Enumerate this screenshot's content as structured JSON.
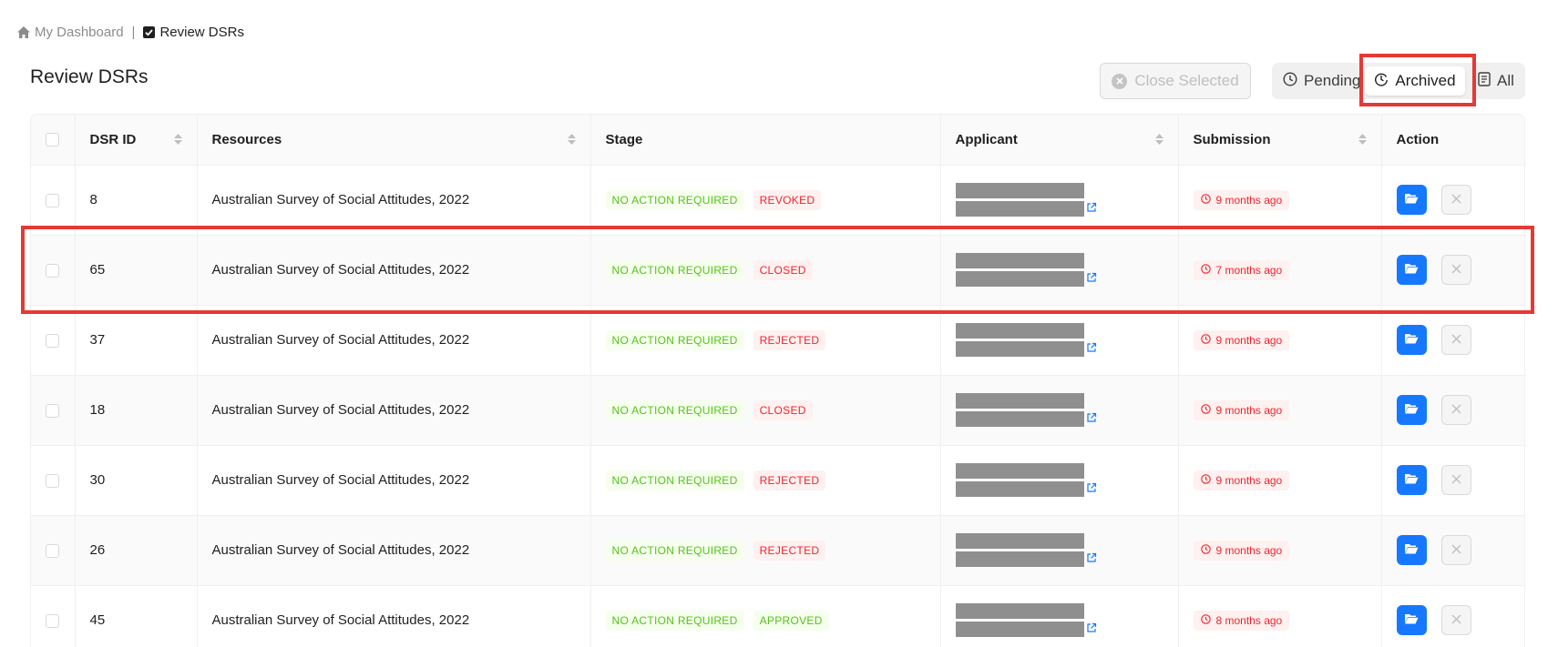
{
  "breadcrumb": {
    "home": "My Dashboard",
    "separator": "|",
    "current": "Review DSRs"
  },
  "page_title": "Review DSRs",
  "toolbar": {
    "close_selected": "Close Selected"
  },
  "filters": {
    "pending": "Pending",
    "archived": "Archived",
    "all": "All",
    "selected": "archived"
  },
  "table": {
    "columns": {
      "id": "DSR ID",
      "resources": "Resources",
      "stage": "Stage",
      "applicant": "Applicant",
      "submission": "Submission",
      "action": "Action"
    },
    "rows": [
      {
        "id": "8",
        "resource": "Australian Survey of Social Attitudes, 2022",
        "stage": "NO ACTION REQUIRED",
        "status": "REVOKED",
        "status_color": "red",
        "submitted": "9 months ago"
      },
      {
        "id": "65",
        "resource": "Australian Survey of Social Attitudes, 2022",
        "stage": "NO ACTION REQUIRED",
        "status": "CLOSED",
        "status_color": "red",
        "submitted": "7 months ago"
      },
      {
        "id": "37",
        "resource": "Australian Survey of Social Attitudes, 2022",
        "stage": "NO ACTION REQUIRED",
        "status": "REJECTED",
        "status_color": "red",
        "submitted": "9 months ago"
      },
      {
        "id": "18",
        "resource": "Australian Survey of Social Attitudes, 2022",
        "stage": "NO ACTION REQUIRED",
        "status": "CLOSED",
        "status_color": "red",
        "submitted": "9 months ago"
      },
      {
        "id": "30",
        "resource": "Australian Survey of Social Attitudes, 2022",
        "stage": "NO ACTION REQUIRED",
        "status": "REJECTED",
        "status_color": "red",
        "submitted": "9 months ago"
      },
      {
        "id": "26",
        "resource": "Australian Survey of Social Attitudes, 2022",
        "stage": "NO ACTION REQUIRED",
        "status": "REJECTED",
        "status_color": "red",
        "submitted": "9 months ago"
      },
      {
        "id": "45",
        "resource": "Australian Survey of Social Attitudes, 2022",
        "stage": "NO ACTION REQUIRED",
        "status": "APPROVED",
        "status_color": "green",
        "submitted": "8 months ago"
      }
    ]
  },
  "colors": {
    "primary": "#1677ff",
    "highlight": "#e53935",
    "success": "#52c41a",
    "danger": "#f5222d"
  }
}
